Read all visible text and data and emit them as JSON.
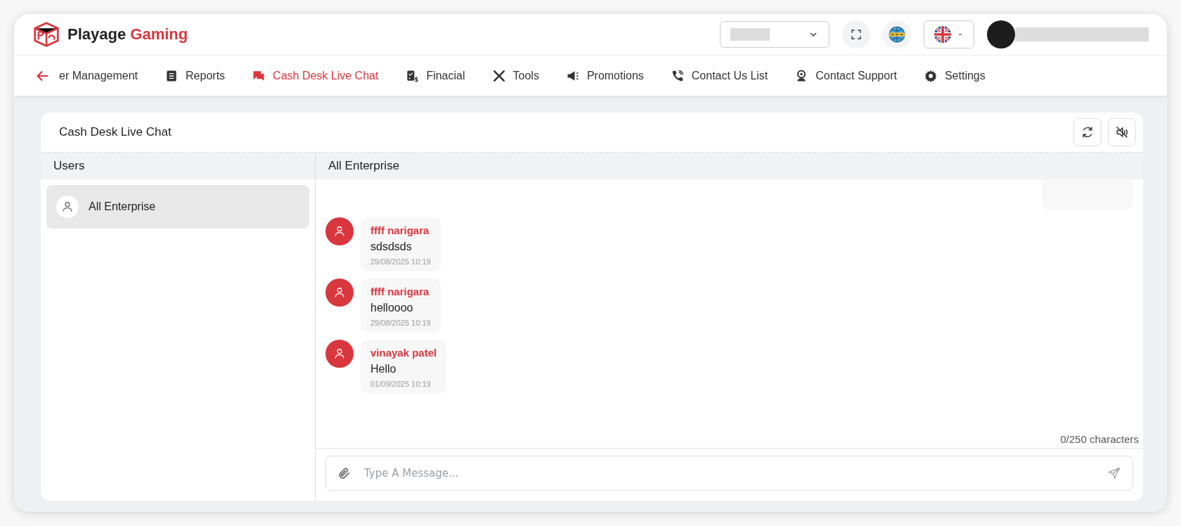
{
  "brand": {
    "name_first": "Playage",
    "name_second": "Gaming"
  },
  "nav": {
    "items": [
      {
        "label": "er Management",
        "selected": false
      },
      {
        "label": "Reports",
        "selected": false
      },
      {
        "label": "Cash Desk Live Chat",
        "selected": true
      },
      {
        "label": "Finacial",
        "selected": false
      },
      {
        "label": "Tools",
        "selected": false
      },
      {
        "label": "Promotions",
        "selected": false
      },
      {
        "label": "Contact Us List",
        "selected": false
      },
      {
        "label": "Contact Support",
        "selected": false
      },
      {
        "label": "Settings",
        "selected": false
      }
    ]
  },
  "panel": {
    "title": "Cash Desk Live Chat",
    "users_heading": "Users",
    "users": [
      {
        "name": "All Enterprise",
        "selected": true
      }
    ],
    "chat_heading": "All Enterprise",
    "messages": [
      {
        "sender": "ffff narigara",
        "text": "sdsdsds",
        "time": "29/08/2025 10:19"
      },
      {
        "sender": "ffff narigara",
        "text": "helloooo",
        "time": "29/08/2025 10:19"
      },
      {
        "sender": "vinayak patel",
        "text": "Hello",
        "time": "01/09/2025 10:19"
      }
    ],
    "counter": "0/250 characters",
    "input": {
      "placeholder": "Type A Message..."
    }
  }
}
